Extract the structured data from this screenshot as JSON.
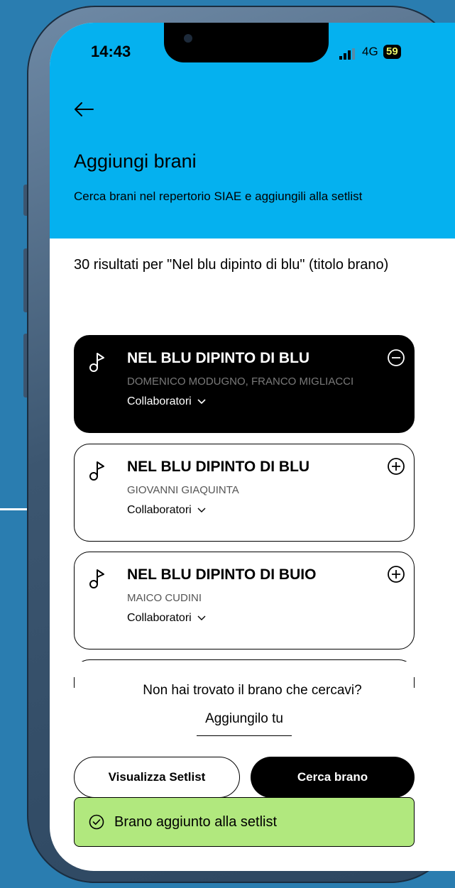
{
  "status_bar": {
    "time": "14:43",
    "network": "4G",
    "battery": "59"
  },
  "header": {
    "title": "Aggiungi brani",
    "subtitle": "Cerca brani nel repertorio SIAE e aggiungili alla setlist"
  },
  "results_text": "30 risultati per \"Nel blu dipinto di blu\" (titolo brano)",
  "songs": [
    {
      "title": "NEL BLU DIPINTO DI BLU",
      "authors": "DOMENICO MODUGNO, FRANCO MIGLIACCI",
      "collab_label": "Collaboratori",
      "selected": true
    },
    {
      "title": "NEL BLU DIPINTO DI BLU",
      "authors": "GIOVANNI GIAQUINTA",
      "collab_label": "Collaboratori",
      "selected": false
    },
    {
      "title": "NEL BLU DIPINTO DI BUIO",
      "authors": "MAICO CUDINI",
      "collab_label": "Collaboratori",
      "selected": false
    }
  ],
  "footer": {
    "not_found": "Non hai trovato il brano che cercavi?",
    "add_yourself": "Aggiungilo tu",
    "view_setlist": "Visualizza Setlist",
    "search_song": "Cerca brano"
  },
  "toast": {
    "message": "Brano aggiunto alla setlist"
  },
  "colors": {
    "header_bg": "#05b1ef",
    "toast_bg": "#b1e87e",
    "battery_text": "#e9f66a"
  }
}
